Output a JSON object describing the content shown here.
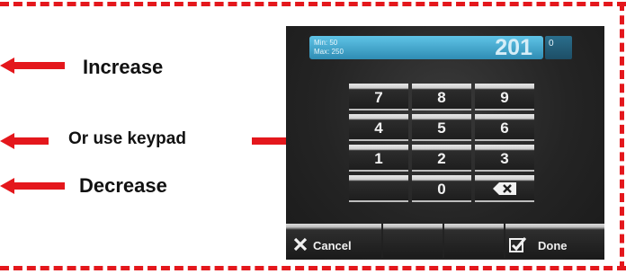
{
  "callouts": {
    "increase": "Increase",
    "keypad": "Or use keypad",
    "decrease": "Decrease"
  },
  "device": {
    "min_label": "Min: 50",
    "max_label": "Max: 250",
    "value": "201",
    "side_value": "0",
    "keys": [
      "7",
      "8",
      "9",
      "4",
      "5",
      "6",
      "1",
      "2",
      "3",
      "",
      "0"
    ],
    "cancel_label": "Cancel",
    "done_label": "Done"
  },
  "colors": {
    "frame": "#e4171c",
    "accent": "#4fb3d9"
  }
}
